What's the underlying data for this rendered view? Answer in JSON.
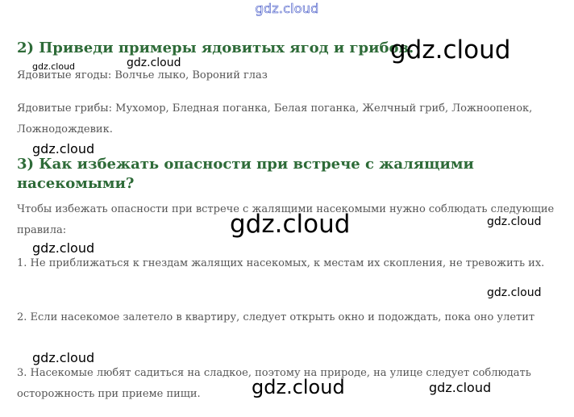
{
  "header": {
    "site_mark": "gdz.cloud"
  },
  "sections": [
    {
      "heading": "2) Приведи примеры ядовитых ягод и грибов.",
      "paragraphs": [
        "Ядовитые ягоды: Волчье лыко, Вороний глаз",
        "Ядовитые грибы: Мухомор, Бледная поганка, Белая поганка, Желчный гриб, Ложноопенок, Ложнодождевик."
      ]
    },
    {
      "heading_line1": "3) Как избежать опасности при встрече с жалящими",
      "heading_line2": "насекомыми?",
      "paragraphs": [
        "Чтобы избежать опасности при встрече с жалящими насекомыми нужно соблюдать следующие правила:",
        "1. Не приближаться к гнездам жалящих насекомых, к местам их скопления, не тревожить их.",
        "2. Если насекомое залетело в квартиру, следует открыть окно и подождать, пока оно улетит",
        "3. Насекомые любят садиться на сладкое, поэтому на природе, на улице следует соблюдать осторожность при приеме пищи."
      ]
    }
  ],
  "watermarks": [
    "gdz.cloud",
    "gdz.cloud",
    "gdz.cloud",
    "gdz.cloud",
    "gdz.cloud",
    "gdz.cloud",
    "gdz.cloud",
    "gdz.cloud",
    "gdz.cloud",
    "gdz.cloud",
    "gdz.cloud",
    "gdz.cloud"
  ]
}
